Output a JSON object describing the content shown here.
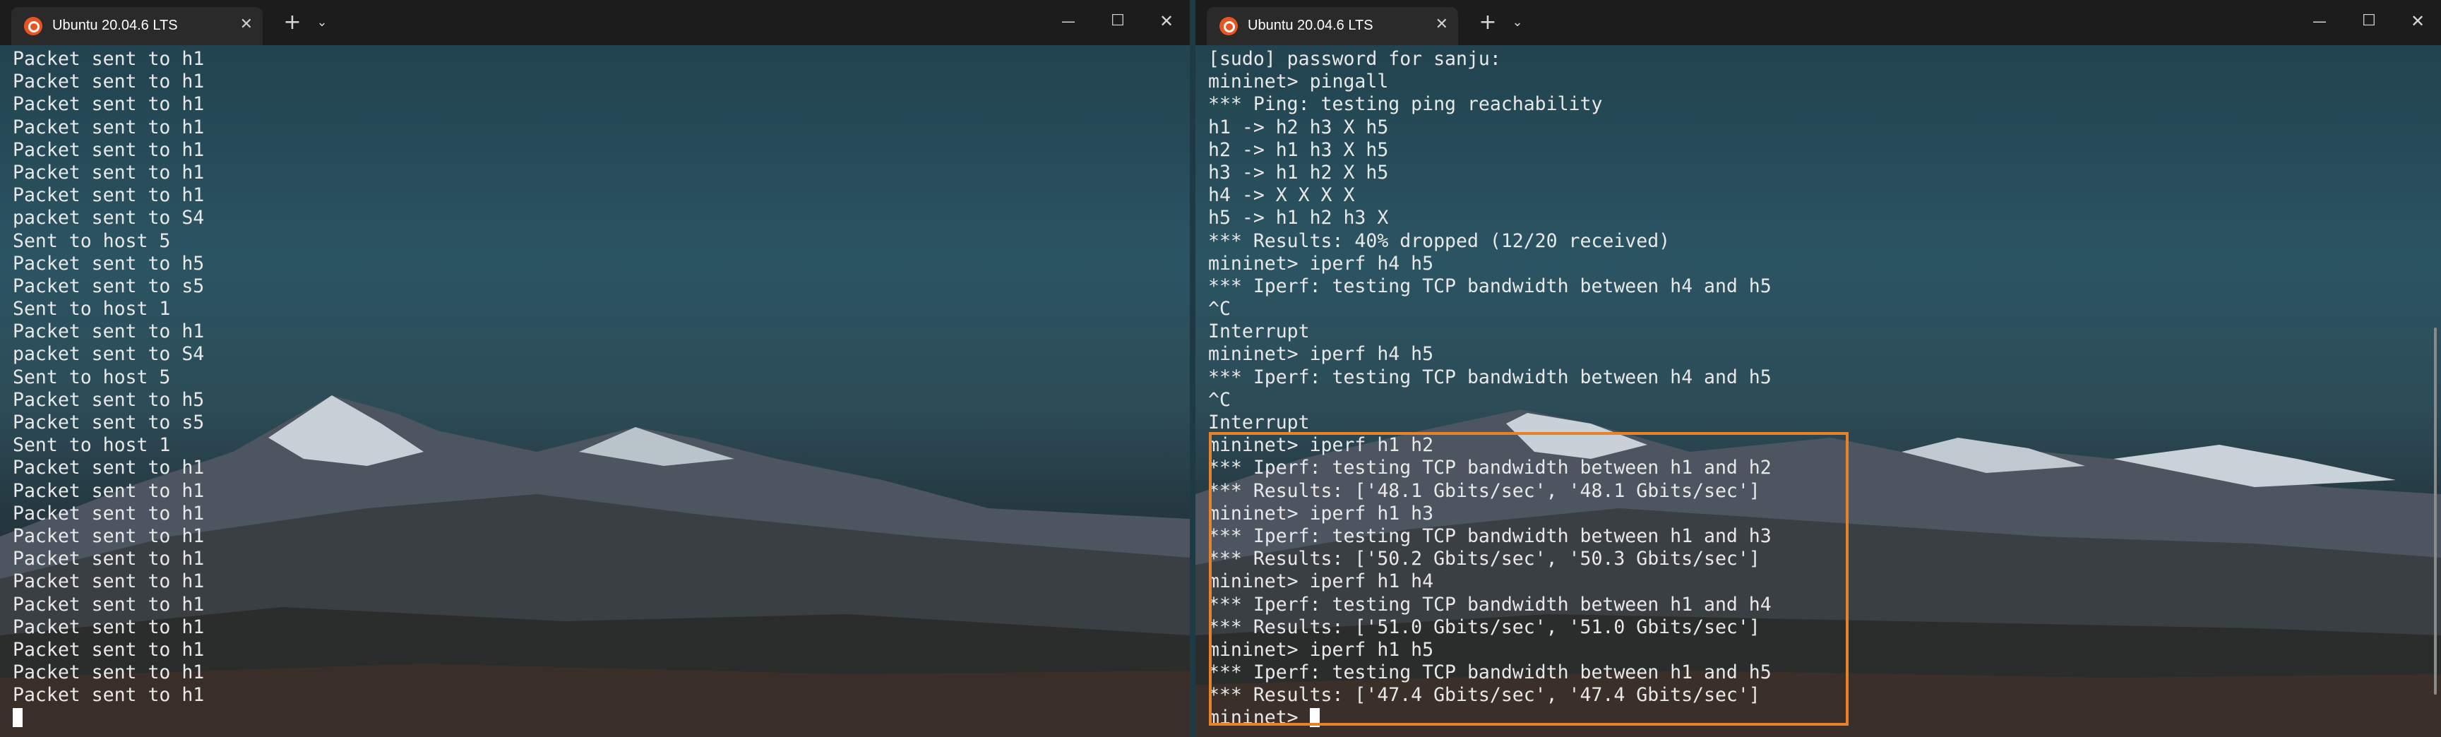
{
  "left_window": {
    "tab_title": "Ubuntu 20.04.6 LTS",
    "lines": [
      "Packet sent to h1",
      "Packet sent to h1",
      "Packet sent to h1",
      "Packet sent to h1",
      "Packet sent to h1",
      "Packet sent to h1",
      "Packet sent to h1",
      "packet sent to S4",
      "Sent to host 5",
      "Packet sent to h5",
      "Packet sent to s5",
      "Sent to host 1",
      "Packet sent to h1",
      "packet sent to S4",
      "Sent to host 5",
      "Packet sent to h5",
      "Packet sent to s5",
      "Sent to host 1",
      "Packet sent to h1",
      "Packet sent to h1",
      "Packet sent to h1",
      "Packet sent to h1",
      "Packet sent to h1",
      "Packet sent to h1",
      "Packet sent to h1",
      "Packet sent to h1",
      "Packet sent to h1",
      "Packet sent to h1",
      "Packet sent to h1"
    ]
  },
  "right_window": {
    "tab_title": "Ubuntu 20.04.6 LTS",
    "lines": [
      "[sudo] password for sanju:",
      "mininet> pingall",
      "*** Ping: testing ping reachability",
      "h1 -> h2 h3 X h5",
      "h2 -> h1 h3 X h5",
      "h3 -> h1 h2 X h5",
      "h4 -> X X X X",
      "h5 -> h1 h2 h3 X",
      "*** Results: 40% dropped (12/20 received)",
      "mininet> iperf h4 h5",
      "*** Iperf: testing TCP bandwidth between h4 and h5",
      "^C",
      "Interrupt",
      "mininet> iperf h4 h5",
      "*** Iperf: testing TCP bandwidth between h4 and h5",
      "^C",
      "Interrupt",
      "mininet> iperf h1 h2",
      "*** Iperf: testing TCP bandwidth between h1 and h2",
      "*** Results: ['48.1 Gbits/sec', '48.1 Gbits/sec']",
      "mininet> iperf h1 h3",
      "*** Iperf: testing TCP bandwidth between h1 and h3",
      "*** Results: ['50.2 Gbits/sec', '50.3 Gbits/sec']",
      "mininet> iperf h1 h4",
      "*** Iperf: testing TCP bandwidth between h1 and h4",
      "*** Results: ['51.0 Gbits/sec', '51.0 Gbits/sec']",
      "mininet> iperf h1 h5",
      "*** Iperf: testing TCP bandwidth between h1 and h5",
      "*** Results: ['47.4 Gbits/sec', '47.4 Gbits/sec']"
    ],
    "prompt": "mininet> "
  },
  "icons": {
    "tab_icon": "ubuntu-icon",
    "tab_close": "close-icon",
    "new_tab": "plus-icon",
    "tab_dropdown": "chevron-down-icon",
    "minimize": "minimize-icon",
    "maximize": "maximize-icon",
    "close": "close-icon"
  },
  "glyphs": {
    "tab_close": "✕",
    "new_tab": "+",
    "dropdown": "⌄",
    "minimize": "—",
    "maximize": "☐",
    "close": "✕"
  },
  "colors": {
    "ubuntu_orange": "#e95420",
    "highlight_border": "#e8822a",
    "terminal_text": "#e8e8e8",
    "titlebar": "#1c1c1c"
  }
}
